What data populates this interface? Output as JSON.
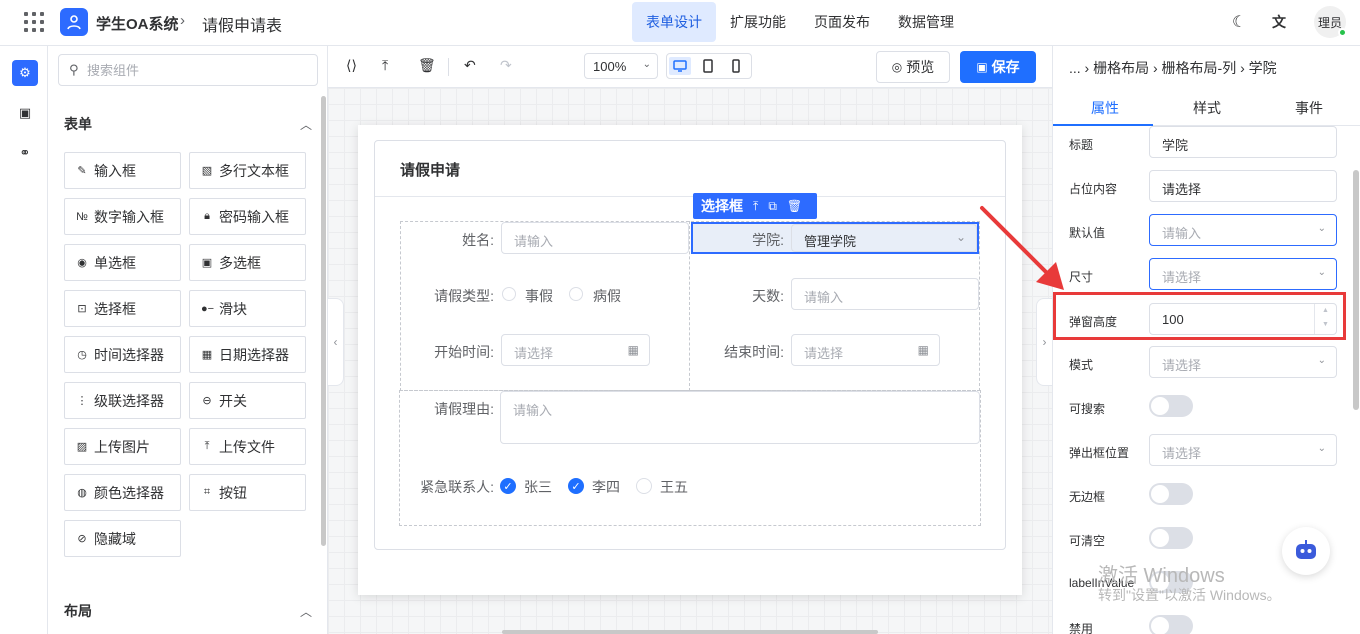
{
  "header": {
    "app_title": "学生OA系统",
    "crumb_sep": "›",
    "page_title": "请假申请表",
    "nav": [
      "表单设计",
      "扩展功能",
      "页面发布",
      "数据管理"
    ],
    "user_label": "理员"
  },
  "palette": {
    "search_placeholder": "搜索组件",
    "form_section": "表单",
    "layout_section": "布局",
    "components": [
      "输入框",
      "多行文本框",
      "数字输入框",
      "密码输入框",
      "单选框",
      "多选框",
      "选择框",
      "滑块",
      "时间选择器",
      "日期选择器",
      "级联选择器",
      "开关",
      "上传图片",
      "上传文件",
      "颜色选择器",
      "按钮",
      "隐藏域"
    ]
  },
  "toolbar": {
    "zoom": "100%",
    "preview": "预览",
    "save": "保存"
  },
  "form": {
    "title": "请假申请",
    "selected_tag": "选择框",
    "fields": {
      "name_label": "姓名:",
      "name_ph": "请输入",
      "college_label": "学院:",
      "college_value": "管理学院",
      "type_label": "请假类型:",
      "type_options": [
        "事假",
        "病假"
      ],
      "days_label": "天数:",
      "days_ph": "请输入",
      "start_label": "开始时间:",
      "start_ph": "请选择",
      "end_label": "结束时间:",
      "end_ph": "请选择",
      "reason_label": "请假理由:",
      "reason_ph": "请输入",
      "contact_label": "紧急联系人:",
      "contacts": [
        "张三",
        "李四",
        "王五"
      ]
    }
  },
  "props": {
    "breadcrumb": "... › 栅格布局 › 栅格布局-列 › 学院",
    "tabs": [
      "属性",
      "样式",
      "事件"
    ],
    "rows": {
      "title_label": "标题",
      "title_value": "学院",
      "placeholder_label": "占位内容",
      "placeholder_value": "请选择",
      "default_label": "默认值",
      "default_ph": "请输入",
      "size_label": "尺寸",
      "size_ph": "请选择",
      "popup_height_label": "弹窗高度",
      "popup_height_value": "100",
      "mode_label": "模式",
      "mode_ph": "请选择",
      "searchable_label": "可搜索",
      "popup_pos_label": "弹出框位置",
      "popup_pos_ph": "请选择",
      "borderless_label": "无边框",
      "clearable_label": "可清空",
      "label_in_value_label": "labelInValue",
      "disabled_label": "禁用"
    }
  },
  "watermark": {
    "line1": "激活 Windows",
    "line2": "转到\"设置\"以激活 Windows。"
  },
  "colors": {
    "primary": "#1f6fff",
    "highlight": "#e83a3a"
  }
}
